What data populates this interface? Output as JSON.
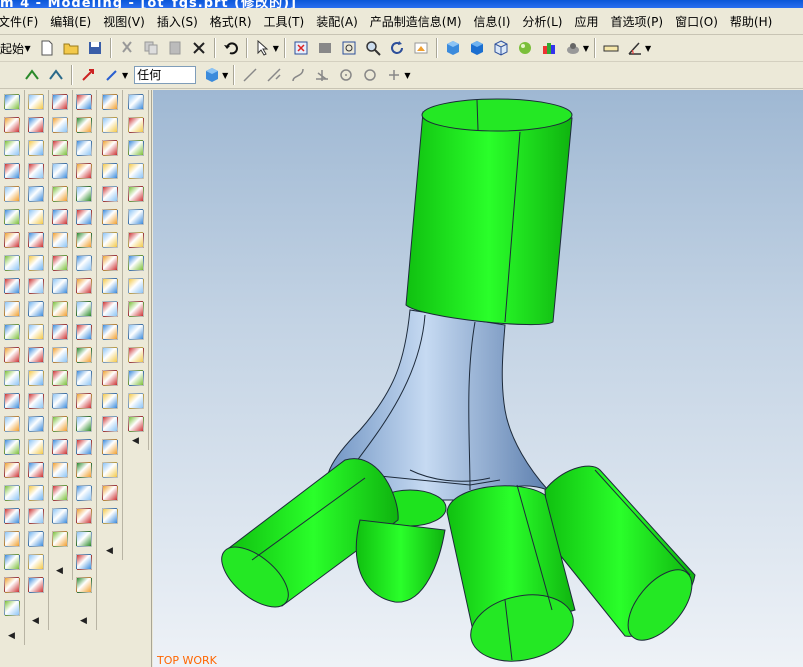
{
  "window": {
    "title": "m 4 - Modeling - [ot_fgs.prt (修改的)]"
  },
  "menu": [
    "文件(F)",
    "编辑(E)",
    "视图(V)",
    "插入(S)",
    "格式(R)",
    "工具(T)",
    "装配(A)",
    "产品制造信息(M)",
    "信息(I)",
    "分析(L)",
    "应用",
    "首选项(P)",
    "窗口(O)",
    "帮助(H)"
  ],
  "toolbar": {
    "start_label": "起始",
    "filter_value": "任何"
  },
  "viewport": {
    "label": "TOP WORK"
  },
  "colors": {
    "part_green": "#1ee31e",
    "part_blue": "#8fb3dc",
    "accent_label": "#ff6600"
  }
}
